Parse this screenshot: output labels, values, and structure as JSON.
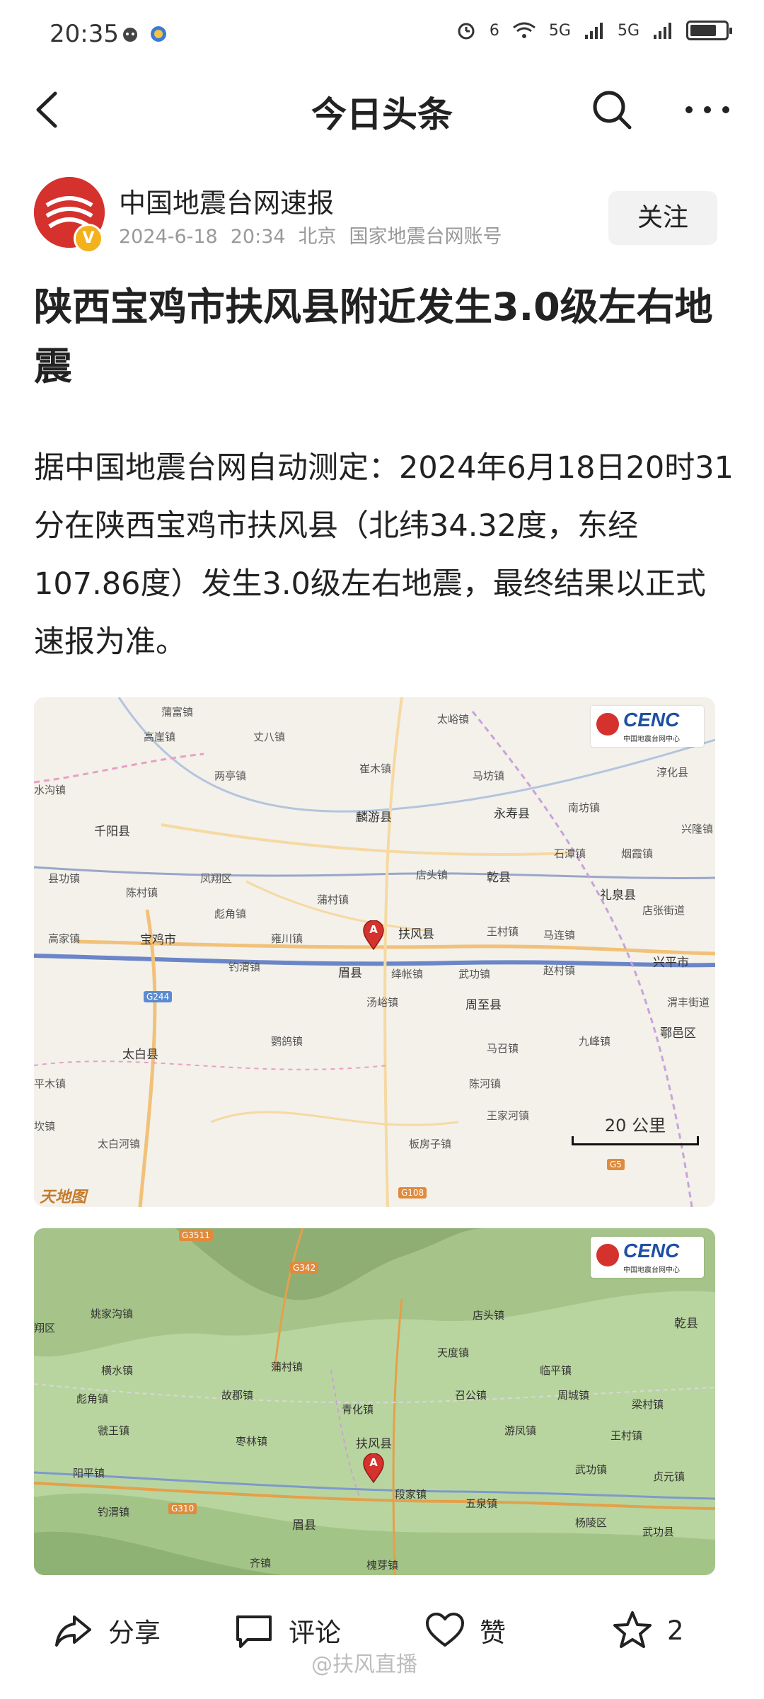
{
  "status_bar": {
    "time": "20:35",
    "network_1": "5G",
    "network_2": "5G",
    "wifi_label": "6"
  },
  "nav": {
    "title": "今日头条",
    "back_icon": "chevron-left-icon",
    "search_icon": "search-icon",
    "more_icon": "more-horizontal-icon"
  },
  "author": {
    "name": "中国地震台网速报",
    "date": "2024-6-18",
    "time": "20:34",
    "location": "北京",
    "account_type": "国家地震台网账号",
    "verified_mark": "V",
    "follow_label": "关注"
  },
  "article": {
    "title": "陕西宝鸡市扶风县附近发生3.0级左右地震",
    "body": "据中国地震台网自动测定：2024年6月18日20时31分在陕西宝鸡市扶风县（北纬34.32度，东经107.86度）发生3.0级左右地震，最终结果以正式速报为准。"
  },
  "map1": {
    "logo_text": "CENC",
    "logo_sub": "中国地震台网中心",
    "epicenter_marker": "A",
    "scale_label": "20 公里",
    "provider": "天地图",
    "roads": [
      "G244",
      "G5",
      "G108"
    ],
    "places": [
      "蒲富镇",
      "太峪镇",
      "高崖镇",
      "丈八镇",
      "两亭镇",
      "崔木镇",
      "马坊镇",
      "淳化县",
      "水沟镇",
      "千阳县",
      "麟游县",
      "永寿县",
      "南坊镇",
      "兴隆镇",
      "县功镇",
      "陈村镇",
      "凤翔区",
      "店头镇",
      "乾县",
      "石潭镇",
      "烟霞镇",
      "礼泉县",
      "彪角镇",
      "蒲村镇",
      "高家镇",
      "宝鸡市",
      "雍川镇",
      "扶风县",
      "王村镇",
      "马连镇",
      "店张街道",
      "钓渭镇",
      "眉县",
      "绛帐镇",
      "武功镇",
      "赵村镇",
      "兴平市",
      "汤峪镇",
      "周至县",
      "渭丰街道",
      "太白县",
      "鹦鸽镇",
      "马召镇",
      "九峰镇",
      "鄠邑区",
      "平木镇",
      "陈河镇",
      "王家河镇",
      "坎镇",
      "太白河镇",
      "板房子镇"
    ]
  },
  "map2": {
    "logo_text": "CENC",
    "logo_sub": "中国地震台网中心",
    "epicenter_marker": "A",
    "roads": [
      "G3511",
      "G342",
      "G310"
    ],
    "places": [
      "姚家沟镇",
      "店头镇",
      "乾县",
      "翔区",
      "天度镇",
      "横水镇",
      "蒲村镇",
      "临平镇",
      "彪角镇",
      "故郡镇",
      "青化镇",
      "召公镇",
      "周城镇",
      "梁村镇",
      "虢王镇",
      "枣林镇",
      "扶风县",
      "游凤镇",
      "王村镇",
      "阳平镇",
      "武功镇",
      "贞元镇",
      "钓渭镇",
      "段家镇",
      "五泉镇",
      "杨陵区",
      "眉县",
      "武功县",
      "齐镇",
      "槐芽镇"
    ]
  },
  "bottom_bar": {
    "share_label": "分享",
    "comment_label": "评论",
    "like_label": "赞",
    "favorite_count": "2",
    "watermark": "@扶风直播"
  }
}
